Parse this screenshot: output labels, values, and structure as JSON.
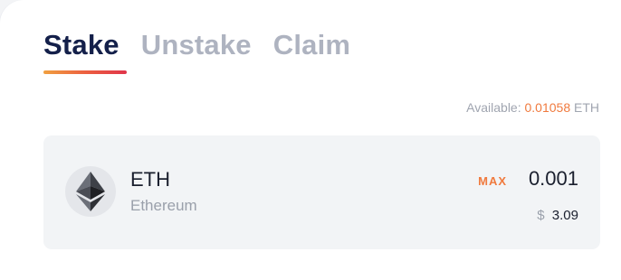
{
  "tabs": [
    {
      "label": "Stake",
      "active": true
    },
    {
      "label": "Unstake",
      "active": false
    },
    {
      "label": "Claim",
      "active": false
    }
  ],
  "available": {
    "label": "Available:",
    "amount": "0.01058",
    "unit": "ETH"
  },
  "token": {
    "symbol": "ETH",
    "name": "Ethereum",
    "icon": "ethereum-icon"
  },
  "input": {
    "max_label": "MAX",
    "value": "0.001"
  },
  "usd": {
    "currency_symbol": "$",
    "value": "3.09"
  },
  "colors": {
    "accent": "#f07a3e",
    "active_tab": "#14204a",
    "inactive_tab": "#aeb3c0",
    "panel_bg": "#f2f4f6"
  }
}
